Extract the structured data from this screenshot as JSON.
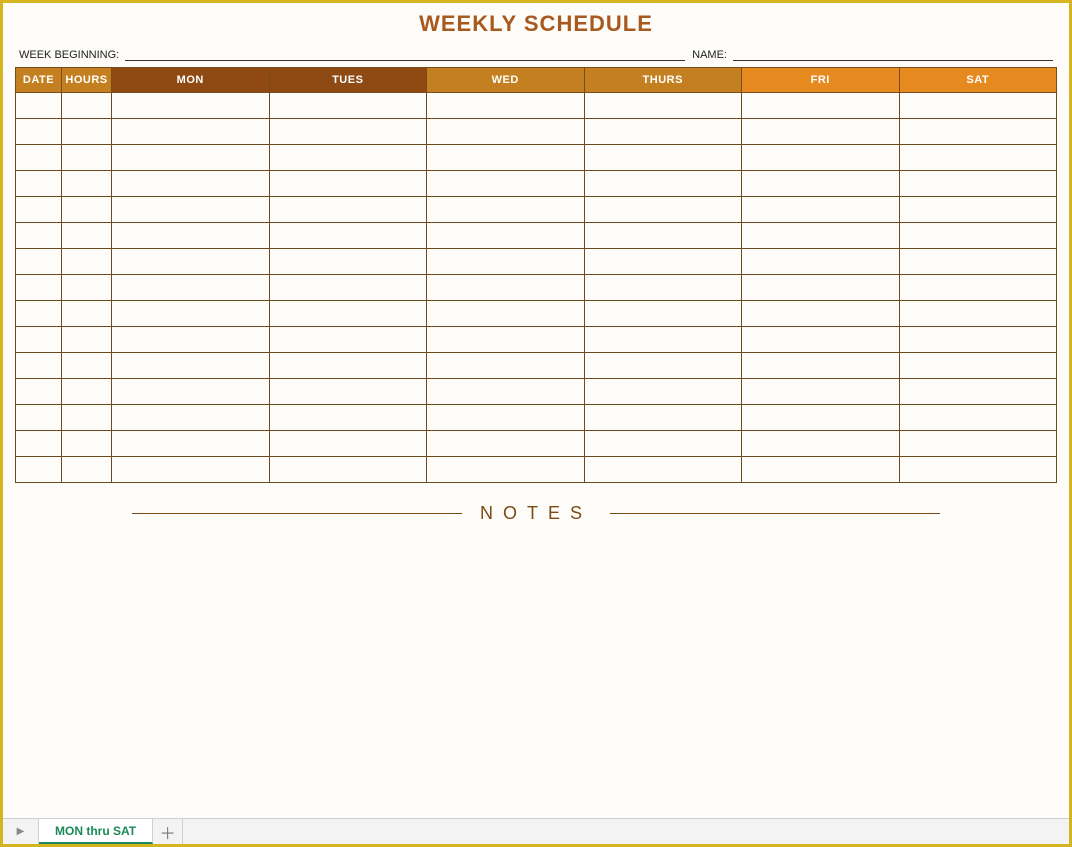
{
  "title": "WEEKLY SCHEDULE",
  "meta": {
    "week_beginning_label": "WEEK BEGINNING:",
    "week_beginning_value": "",
    "name_label": "NAME:",
    "name_value": ""
  },
  "columns": {
    "date": "DATE",
    "hours": "HOURS",
    "mon": "MON",
    "tues": "TUES",
    "wed": "WED",
    "thurs": "THURS",
    "fri": "FRI",
    "sat": "SAT"
  },
  "rows": [
    {
      "date": "",
      "hours": "",
      "mon": "",
      "tues": "",
      "wed": "",
      "thurs": "",
      "fri": "",
      "sat": ""
    },
    {
      "date": "",
      "hours": "",
      "mon": "",
      "tues": "",
      "wed": "",
      "thurs": "",
      "fri": "",
      "sat": ""
    },
    {
      "date": "",
      "hours": "",
      "mon": "",
      "tues": "",
      "wed": "",
      "thurs": "",
      "fri": "",
      "sat": ""
    },
    {
      "date": "",
      "hours": "",
      "mon": "",
      "tues": "",
      "wed": "",
      "thurs": "",
      "fri": "",
      "sat": ""
    },
    {
      "date": "",
      "hours": "",
      "mon": "",
      "tues": "",
      "wed": "",
      "thurs": "",
      "fri": "",
      "sat": ""
    },
    {
      "date": "",
      "hours": "",
      "mon": "",
      "tues": "",
      "wed": "",
      "thurs": "",
      "fri": "",
      "sat": ""
    },
    {
      "date": "",
      "hours": "",
      "mon": "",
      "tues": "",
      "wed": "",
      "thurs": "",
      "fri": "",
      "sat": ""
    },
    {
      "date": "",
      "hours": "",
      "mon": "",
      "tues": "",
      "wed": "",
      "thurs": "",
      "fri": "",
      "sat": ""
    },
    {
      "date": "",
      "hours": "",
      "mon": "",
      "tues": "",
      "wed": "",
      "thurs": "",
      "fri": "",
      "sat": ""
    },
    {
      "date": "",
      "hours": "",
      "mon": "",
      "tues": "",
      "wed": "",
      "thurs": "",
      "fri": "",
      "sat": ""
    },
    {
      "date": "",
      "hours": "",
      "mon": "",
      "tues": "",
      "wed": "",
      "thurs": "",
      "fri": "",
      "sat": ""
    },
    {
      "date": "",
      "hours": "",
      "mon": "",
      "tues": "",
      "wed": "",
      "thurs": "",
      "fri": "",
      "sat": ""
    },
    {
      "date": "",
      "hours": "",
      "mon": "",
      "tues": "",
      "wed": "",
      "thurs": "",
      "fri": "",
      "sat": ""
    },
    {
      "date": "",
      "hours": "",
      "mon": "",
      "tues": "",
      "wed": "",
      "thurs": "",
      "fri": "",
      "sat": ""
    },
    {
      "date": "",
      "hours": "",
      "mon": "",
      "tues": "",
      "wed": "",
      "thurs": "",
      "fri": "",
      "sat": ""
    }
  ],
  "notes_label": "NOTES",
  "tabs": {
    "active": "MON thru SAT"
  }
}
